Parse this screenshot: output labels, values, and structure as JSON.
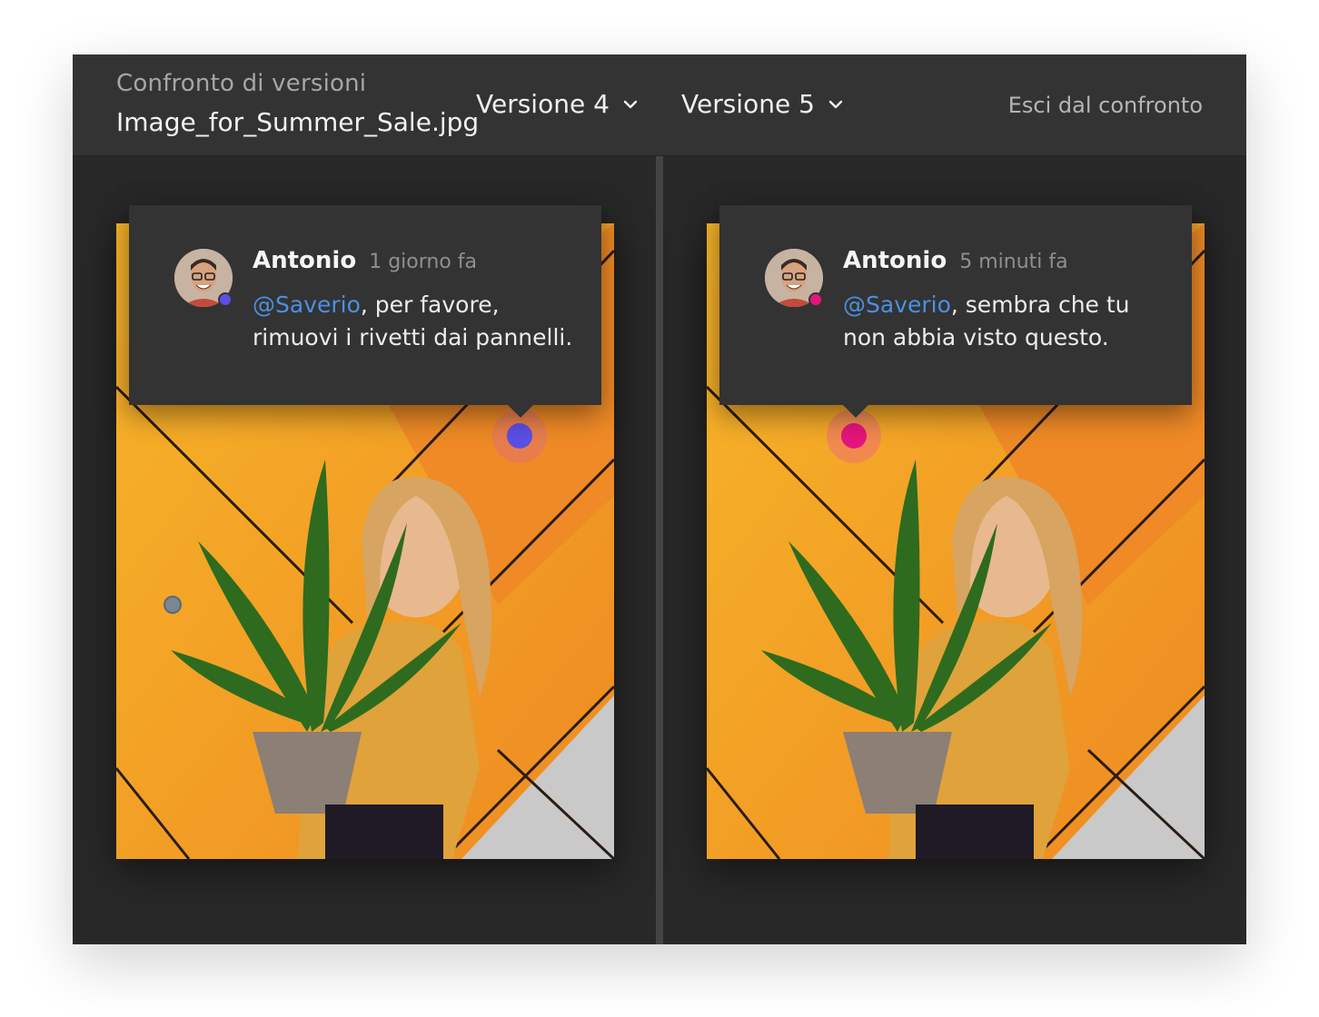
{
  "header": {
    "app_title": "Confronto di versioni",
    "file_name": "Image_for_Summer_Sale.jpg",
    "left_version": "Versione 4",
    "right_version": "Versione 5",
    "exit_label": "Esci dal confronto"
  },
  "left_pane": {
    "comment": {
      "author": "Antonio",
      "time": "1 giorno fa",
      "mention": "@Saverio",
      "text": ", per favore, rimuovi i rivetti dai pannelli."
    },
    "pin_color": "#5b4fe6"
  },
  "right_pane": {
    "comment": {
      "author": "Antonio",
      "time": "5 minuti fa",
      "mention": "@Saverio",
      "text": ", sembra che tu non abbia visto questo."
    },
    "pin_color": "#e5157d"
  },
  "colors": {
    "accent_mention": "#4a90e2",
    "panel_bg": "#333333",
    "window_bg": "#282828"
  },
  "icons": [
    "chevron-down-icon",
    "avatar",
    "comment-pin"
  ]
}
